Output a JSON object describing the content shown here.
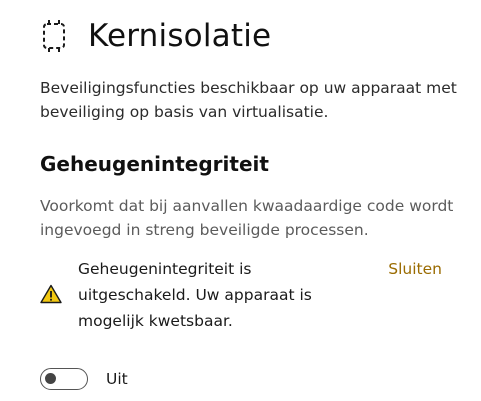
{
  "header": {
    "title": "Kernisolatie",
    "icon": "core-isolation-chip-icon"
  },
  "description": "Beveiligingsfuncties beschikbaar op uw apparaat met beveiliging op basis van virtualisatie.",
  "memory_integrity": {
    "title": "Geheugenintegriteit",
    "description": "Voorkomt dat bij aanvallen kwaadaardige code wordt ingevoegd in streng beveiligde processen.",
    "warning": {
      "icon": "warning-triangle-icon",
      "text": "Geheugenintegriteit is uitgeschakeld. Uw apparaat is mogelijk kwetsbaar.",
      "dismiss_label": "Sluiten"
    },
    "toggle": {
      "state": "off",
      "label": "Uit"
    }
  },
  "colors": {
    "warning_fill": "#f2c811",
    "link": "#9a6b00",
    "secondary_text": "#5b5b5b"
  }
}
